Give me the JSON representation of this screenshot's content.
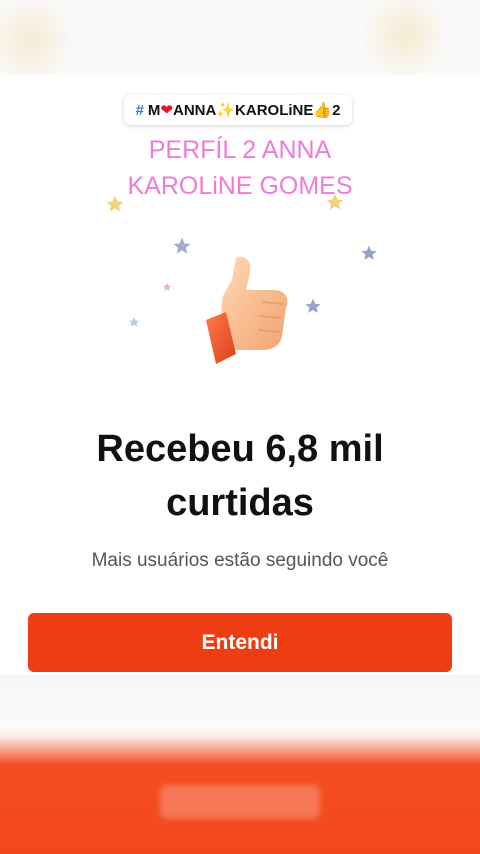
{
  "tag_chip": {
    "hash": "#",
    "part1": "M",
    "heart": "❤",
    "part2": "ANNA",
    "sparkle": "✨",
    "part3": "KAROLiNE",
    "thumb": "👍",
    "part4": "2"
  },
  "profile_title": {
    "line1": "PERFÍL 2 ANNA",
    "line2": "KAROLiNE GOMES"
  },
  "headline": {
    "line1": "Recebeu 6,8 mil",
    "line2": "curtidas"
  },
  "subtext": "Mais usuários estão seguindo você",
  "cta_label": "Entendi",
  "colors": {
    "accent": "#ee3d12",
    "title_pink": "#f07ad9",
    "hash_blue": "#2a7de1"
  },
  "icons": [
    "thumbs-up-icon",
    "star-icon",
    "heart-icon",
    "sparkle-icon"
  ]
}
